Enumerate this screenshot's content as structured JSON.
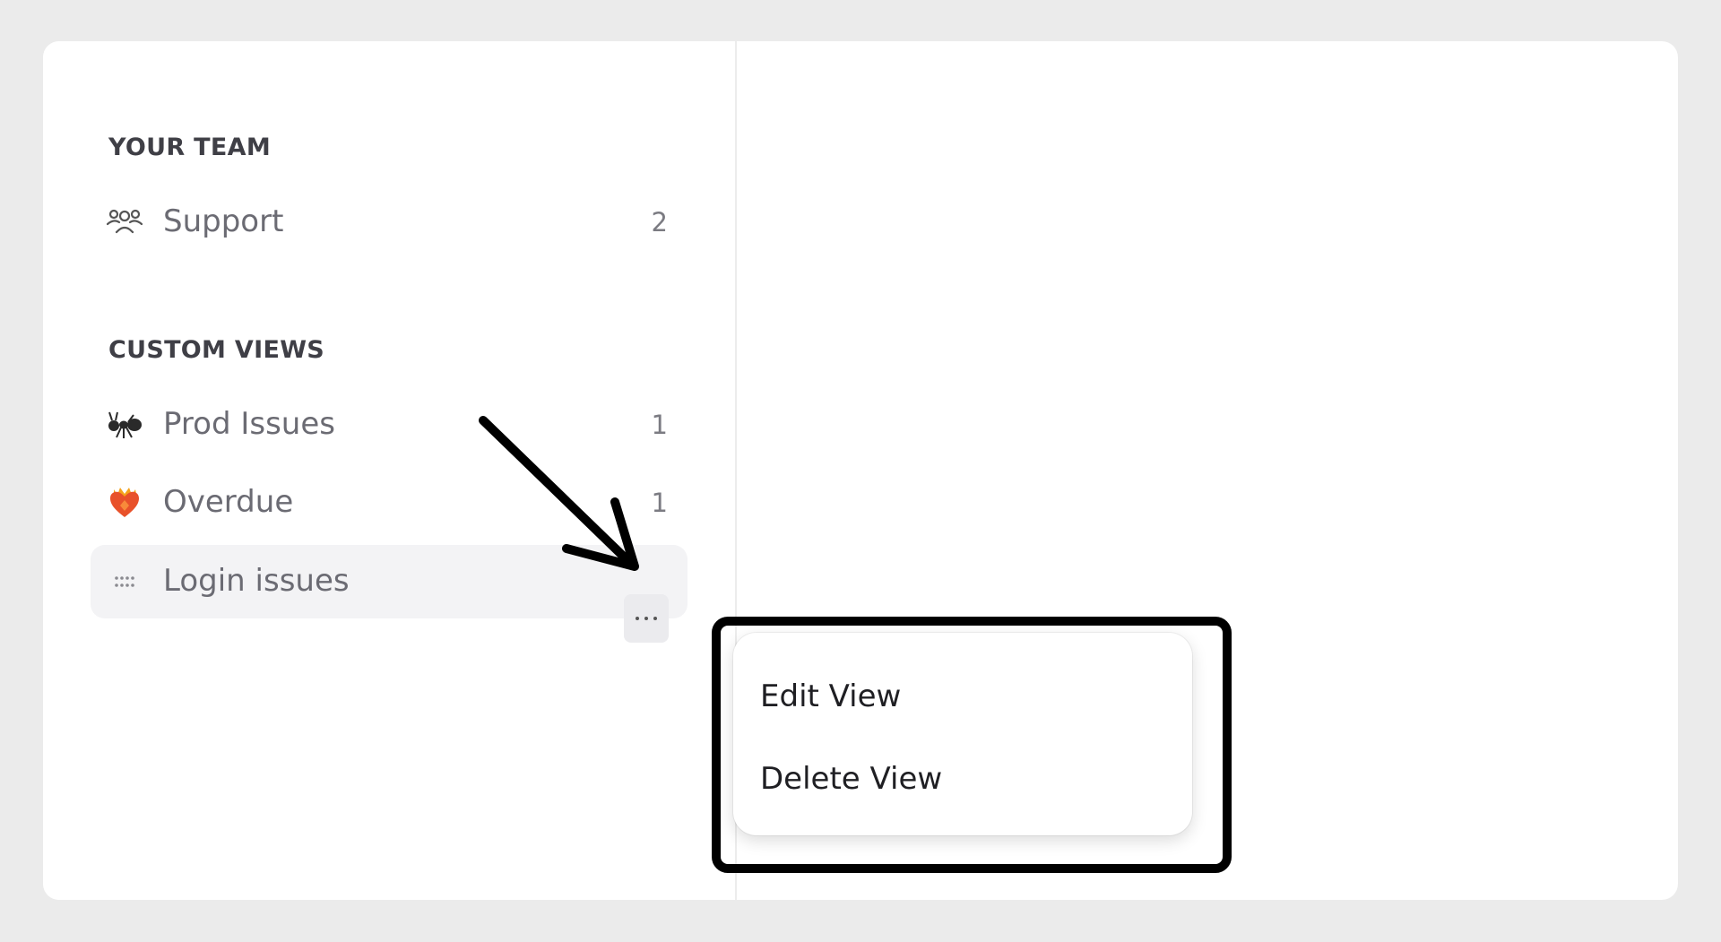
{
  "sidebar": {
    "your_team": {
      "heading": "YOUR TEAM",
      "items": [
        {
          "label": "Support",
          "count": "2",
          "icon": "team-icon"
        }
      ]
    },
    "custom_views": {
      "heading": "CUSTOM VIEWS",
      "items": [
        {
          "label": "Prod Issues",
          "count": "1",
          "icon": "ant-emoji-icon"
        },
        {
          "label": "Overdue",
          "count": "1",
          "icon": "heart-on-fire-emoji-icon"
        },
        {
          "label": "Login issues",
          "count": "",
          "icon": "drag-handle-icon",
          "active": true
        }
      ]
    }
  },
  "context_menu": {
    "trigger_icon": "more-horizontal-icon",
    "items": [
      {
        "label": "Edit View"
      },
      {
        "label": "Delete View"
      }
    ]
  },
  "annotation": {
    "arrow_color": "#000000",
    "frame_color": "#000000"
  }
}
